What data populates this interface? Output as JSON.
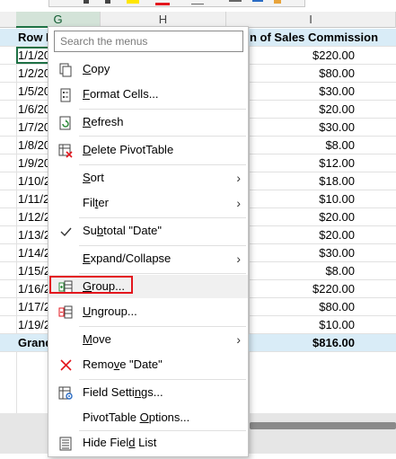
{
  "sheet": {
    "columns": [
      {
        "label": "G"
      },
      {
        "label": "H"
      },
      {
        "label": "I"
      }
    ],
    "header_row": {
      "g": "Row L",
      "i": "n of Sales Commission"
    },
    "rows": [
      {
        "g": "1/1/20",
        "i": "$220.00"
      },
      {
        "g": "1/2/20",
        "i": "$80.00"
      },
      {
        "g": "1/5/20",
        "i": "$30.00"
      },
      {
        "g": "1/6/20",
        "i": "$20.00"
      },
      {
        "g": "1/7/20",
        "i": "$30.00"
      },
      {
        "g": "1/8/20",
        "i": "$8.00"
      },
      {
        "g": "1/9/20",
        "i": "$12.00"
      },
      {
        "g": "1/10/2",
        "i": "$18.00"
      },
      {
        "g": "1/11/2",
        "i": "$10.00"
      },
      {
        "g": "1/12/2",
        "i": "$20.00"
      },
      {
        "g": "1/13/2",
        "i": "$20.00"
      },
      {
        "g": "1/14/2",
        "i": "$30.00"
      },
      {
        "g": "1/15/2",
        "i": "$8.00"
      },
      {
        "g": "1/16/2",
        "i": "$220.00"
      },
      {
        "g": "1/17/2",
        "i": "$80.00"
      },
      {
        "g": "1/19/2",
        "i": "$10.00"
      }
    ],
    "total_row": {
      "g": "Grand",
      "i": "$816.00"
    },
    "toolbar_colors": {
      "highlight": "#ffe600",
      "font": "#e3161d",
      "accent": "#1e7145"
    }
  },
  "menu": {
    "search_placeholder": "Search the menus",
    "items": [
      {
        "pre": "",
        "ul": "C",
        "post": "opy",
        "icon": "copy-icon"
      },
      {
        "pre": "",
        "ul": "F",
        "post": "ormat Cells...",
        "icon": "format-cells-icon"
      },
      {
        "pre": "",
        "ul": "R",
        "post": "efresh",
        "icon": "refresh-icon"
      },
      {
        "pre": "",
        "ul": "D",
        "post": "elete PivotTable",
        "icon": "delete-pivottable-icon"
      },
      {
        "pre": "",
        "ul": "S",
        "post": "ort",
        "icon": ""
      },
      {
        "pre": "Fil",
        "ul": "t",
        "post": "er",
        "icon": ""
      },
      {
        "pre": "Su",
        "ul": "b",
        "post": "total \"Date\"",
        "icon": "checkmark-icon"
      },
      {
        "pre": "",
        "ul": "E",
        "post": "xpand/Collapse",
        "icon": ""
      },
      {
        "pre": "",
        "ul": "G",
        "post": "roup...",
        "icon": "group-icon"
      },
      {
        "pre": "",
        "ul": "U",
        "post": "ngroup...",
        "icon": "ungroup-icon"
      },
      {
        "pre": "",
        "ul": "M",
        "post": "ove",
        "icon": ""
      },
      {
        "pre": "Remo",
        "ul": "v",
        "post": "e \"Date\"",
        "icon": "remove-icon"
      },
      {
        "pre": "Field Setti",
        "ul": "n",
        "post": "gs...",
        "icon": "field-settings-icon"
      },
      {
        "pre": "PivotTable ",
        "ul": "O",
        "post": "ptions...",
        "icon": ""
      },
      {
        "pre": "Hide Fiel",
        "ul": "d",
        "post": " List",
        "icon": "field-list-icon"
      }
    ],
    "highlight_color": "#e3161d"
  }
}
